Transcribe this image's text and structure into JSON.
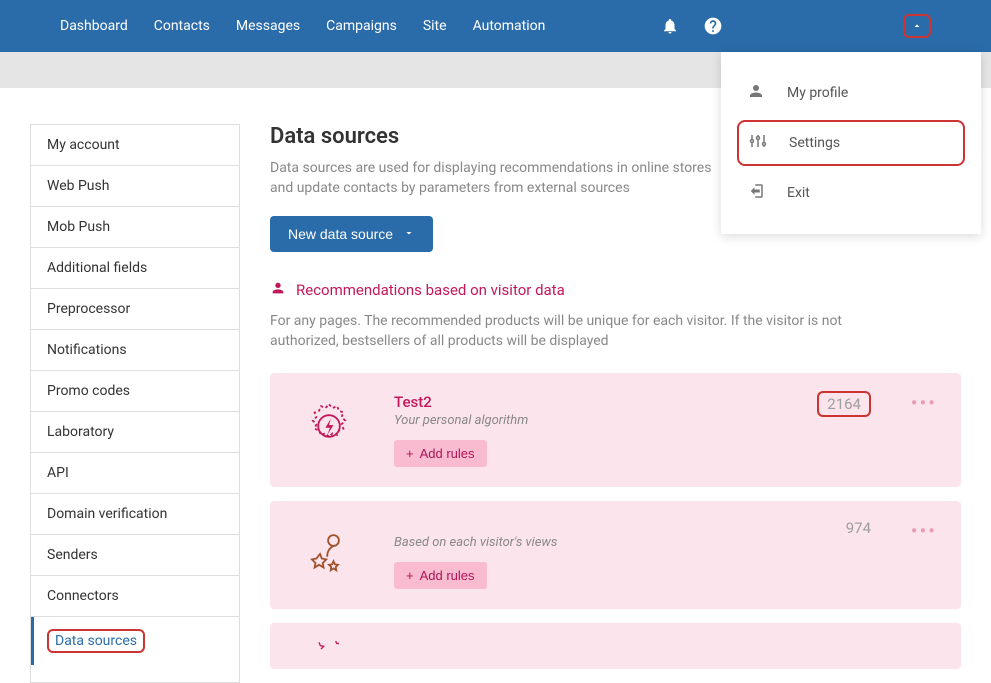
{
  "topnav": {
    "links": [
      "Dashboard",
      "Contacts",
      "Messages",
      "Campaigns",
      "Site",
      "Automation"
    ]
  },
  "profile_menu": {
    "items": [
      {
        "label": "My profile",
        "icon": "person-icon"
      },
      {
        "label": "Settings",
        "icon": "sliders-icon"
      },
      {
        "label": "Exit",
        "icon": "exit-icon"
      }
    ]
  },
  "sidebar": {
    "items": [
      "My account",
      "Web Push",
      "Mob Push",
      "Additional fields",
      "Preprocessor",
      "Notifications",
      "Promo codes",
      "Laboratory",
      "API",
      "Domain verification",
      "Senders",
      "Connectors",
      "Data sources"
    ]
  },
  "main": {
    "title": "Data sources",
    "description": "Data sources are used for displaying recommendations in online stores and update contacts by parameters from external sources",
    "new_btn": "New data source"
  },
  "section": {
    "heading": "Recommendations based on visitor data",
    "description": "For any pages. The recommended products will be unique for each visitor. If the visitor is not authorized, bestsellers of all products will be displayed"
  },
  "cards": [
    {
      "title": "Test2",
      "subtitle": "Your personal algorithm",
      "count": "2164",
      "add_rules": "Add rules"
    },
    {
      "title": "",
      "subtitle": "Based on each visitor's views",
      "count": "974",
      "add_rules": "Add rules"
    }
  ]
}
